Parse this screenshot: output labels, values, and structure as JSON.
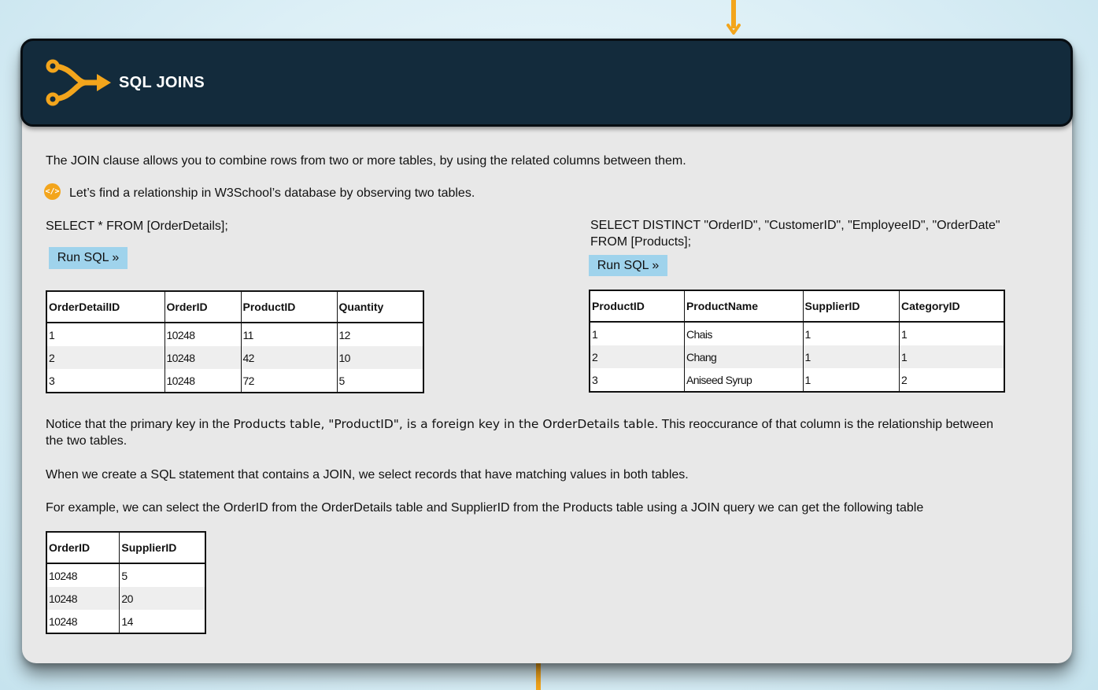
{
  "header": {
    "title": "SQL JOINS"
  },
  "intro": {
    "line1": "The JOIN clause allows you to combine rows from two or more tables, by using the related columns between them.",
    "tip": "Let’s find a relationship in W3School’s database by observing two tables."
  },
  "left_query": {
    "sql": "SELECT  * FROM [OrderDetails];",
    "button": "Run SQL »",
    "table": {
      "headers": [
        "OrderDetailID",
        "OrderID",
        "ProductID",
        "Quantity"
      ],
      "rows": [
        [
          "1",
          "10248",
          "11",
          "12"
        ],
        [
          "2",
          "10248",
          "42",
          "10"
        ],
        [
          "3",
          "10248",
          "72",
          "5"
        ]
      ]
    }
  },
  "right_query": {
    "sql_line1": "SELECT DISTINCT \"OrderID\", \"CustomerID\", \"EmployeeID\", \"OrderDate\"",
    "sql_line2": "FROM [Products];",
    "button": "Run SQL »",
    "table": {
      "headers": [
        "ProductID",
        "ProductName",
        "SupplierID",
        "CategoryID"
      ],
      "rows": [
        [
          "1",
          "Chais",
          "1",
          "1"
        ],
        [
          "2",
          "Chang",
          "1",
          "1"
        ],
        [
          "3",
          "Aniseed Syrup",
          "1",
          "2"
        ]
      ]
    }
  },
  "notice": {
    "part1": "Notice that the primary key in the ",
    "part2": "Products table, \"ProductID\", is a foreign key in the OrderDetails table.",
    "part3": " This reoccurance of that column is the relationship between",
    "line2": "the two tables."
  },
  "paragraph2": "When we create a SQL statement that contains a JOIN, we select records that have matching values in both tables.",
  "paragraph3": "For example, we can select the OrderID from the OrderDetails table and SupplierID from the Products table using a JOIN query we can get the following table",
  "result_table": {
    "headers": [
      "OrderID",
      "SupplierID"
    ],
    "rows": [
      [
        "10248",
        "5"
      ],
      [
        "10248",
        "20"
      ],
      [
        "10248",
        "14"
      ]
    ]
  },
  "colors": {
    "header_bg": "#132b3c",
    "accent": "#f3a51c",
    "button_bg": "#9fd3ec",
    "card_bg": "#e8e8e8"
  },
  "icons": {
    "logo": "join-arrow-icon",
    "tip": "code-icon"
  }
}
